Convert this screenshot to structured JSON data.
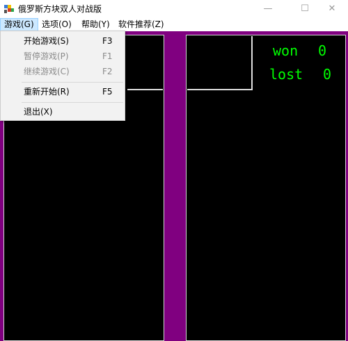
{
  "window": {
    "title": "俄罗斯方块双人对战版",
    "minimize_glyph": "—",
    "maximize_glyph": "☐",
    "close_glyph": "✕",
    "icon": "tetris-app-icon"
  },
  "menubar": {
    "items": [
      {
        "label": "游戏(G)"
      },
      {
        "label": "选项(O)"
      },
      {
        "label": "帮助(Y)"
      },
      {
        "label": "软件推荐(Z)"
      }
    ]
  },
  "game_menu": {
    "items": [
      {
        "label": "开始游戏(S)",
        "shortcut": "F3",
        "enabled": true
      },
      {
        "label": "暂停游戏(P)",
        "shortcut": "F1",
        "enabled": false
      },
      {
        "label": "继续游戏(C)",
        "shortcut": "F2",
        "enabled": false
      },
      {
        "label": "重新开始(R)",
        "shortcut": "F5",
        "enabled": true
      },
      {
        "label": "退出(X)",
        "shortcut": "",
        "enabled": true
      }
    ]
  },
  "scoreboard": {
    "won_label": "won",
    "won_value": "0",
    "lost_label": "lost",
    "lost_value": "0"
  },
  "colors": {
    "background": "#800080",
    "board": "#000000",
    "score_text": "#00ff00",
    "menu_highlight": "#cce8ff"
  }
}
